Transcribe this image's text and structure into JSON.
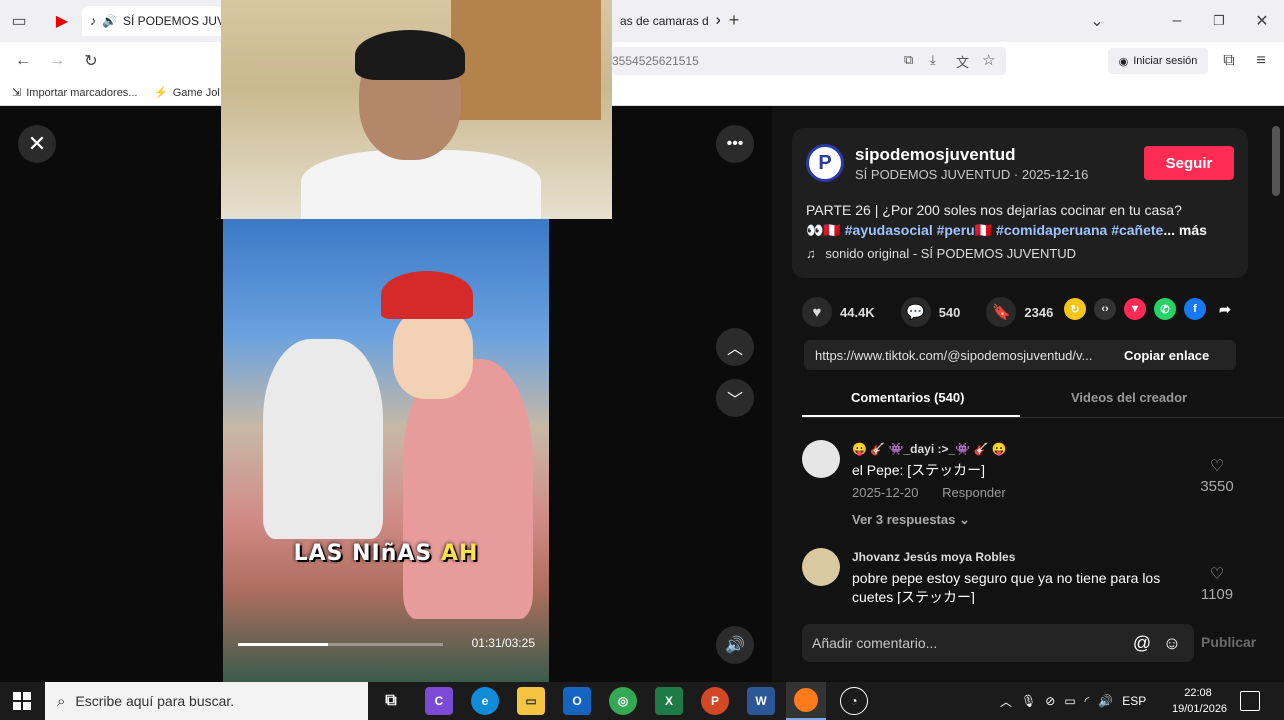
{
  "browser": {
    "tabs": [
      {
        "label": "SÍ PODEMOS JUVEN"
      },
      {
        "label": "as de camaras d"
      }
    ],
    "url_fragment": "3554525621515",
    "sign_in": "Iniciar sesión",
    "bookmarks": [
      {
        "label": "Importar marcadores..."
      },
      {
        "label": "Game Jolt"
      }
    ]
  },
  "video": {
    "caption_main": "LAS NIñAS",
    "caption_highlight": "AH",
    "time": "01:31/03:25",
    "progress": 0.44
  },
  "post": {
    "username": "sipodemosjuventud",
    "display_name_date": "SÍ PODEMOS JUVENTUD · 2025-12-16",
    "follow_label": "Seguir",
    "description": "PARTE 26 | ¿Por 200 soles nos dejarías cocinar en tu casa?",
    "tags_prefix": "👀🇵🇪 ",
    "tags": "#ayudasocial #peru🇵🇪 #comidaperuana #cañete",
    "more": "... más",
    "sound": "sonido original - SÍ PODEMOS JUVENTUD",
    "likes": "44.4K",
    "comments_count": "540",
    "saves": "2346",
    "link": "https://www.tiktok.com/@sipodemosjuventud/v...",
    "copy_label": "Copiar enlace",
    "tab_comments": "Comentarios (540)",
    "tab_videos": "Videos del creador"
  },
  "comments": [
    {
      "name": "😛 🎸 👾_dayi :>_👾 🎸 😛",
      "text": "el Pepe: [ステッカー]",
      "date": "2025-12-20",
      "reply": "Responder",
      "likes": "3550",
      "replies": "Ver 3 respuestas ⌄"
    },
    {
      "name": "Jhovanz Jesús moya Robles",
      "text": "pobre pepe estoy seguro que ya no tiene para los cuetes [ステッカー]",
      "likes": "1109"
    }
  ],
  "comment_input": {
    "placeholder": "Añadir comentario...",
    "publish": "Publicar"
  },
  "taskbar": {
    "search_placeholder": "Escribe aquí para buscar.",
    "lang": "ESP",
    "time": "22:08",
    "date": "19/01/2026"
  },
  "colors": {
    "accent": "#fe2c55",
    "tag": "#9ec4ff",
    "background": "#121212"
  }
}
